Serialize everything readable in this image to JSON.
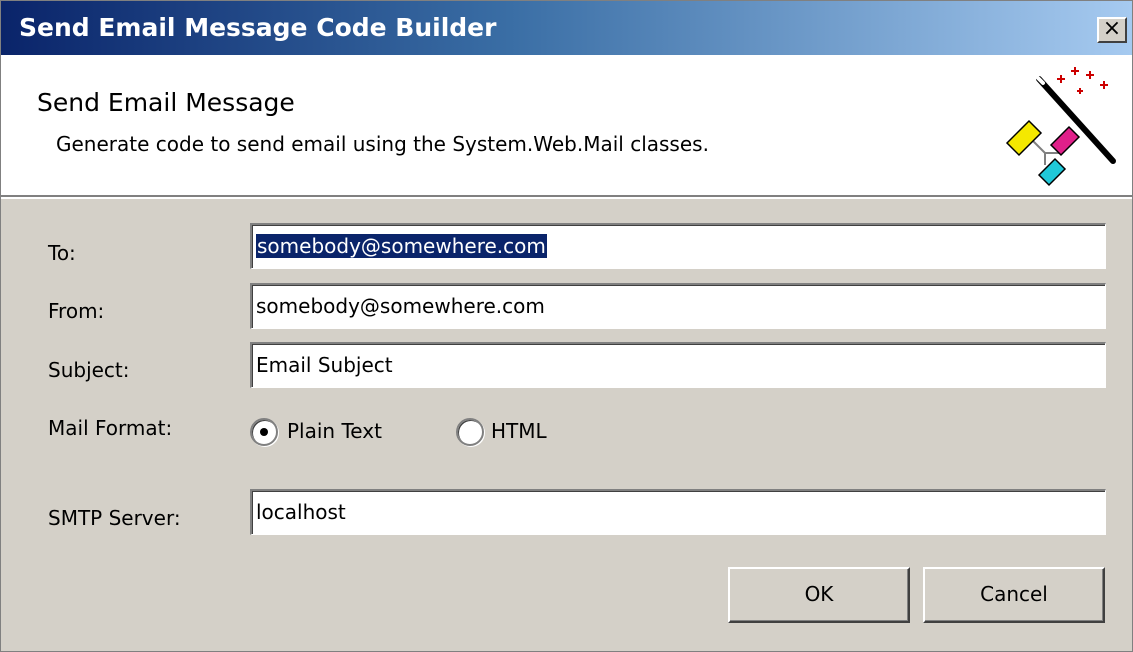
{
  "window": {
    "title": "Send Email Message Code Builder",
    "close_glyph": "×"
  },
  "header": {
    "title": "Send Email Message",
    "description": "Generate code to send email using the System.Web.Mail classes.",
    "icon": "magic-wand-icon"
  },
  "form": {
    "to": {
      "label": "To:",
      "value": "somebody@somewhere.com",
      "selected": true
    },
    "from": {
      "label": "From:",
      "value": "somebody@somewhere.com"
    },
    "subject": {
      "label": "Subject:",
      "value": "Email Subject"
    },
    "mail_format": {
      "label": "Mail Format:",
      "options": [
        {
          "label": "Plain Text",
          "checked": true
        },
        {
          "label": "HTML",
          "checked": false
        }
      ]
    },
    "smtp_server": {
      "label": "SMTP Server:",
      "value": "localhost"
    }
  },
  "buttons": {
    "ok": "OK",
    "cancel": "Cancel"
  },
  "colors": {
    "titlebar_start": "#0a246a",
    "titlebar_end": "#a6caf0",
    "dialog_bg": "#d4d0c8",
    "selection_bg": "#0a246a"
  }
}
